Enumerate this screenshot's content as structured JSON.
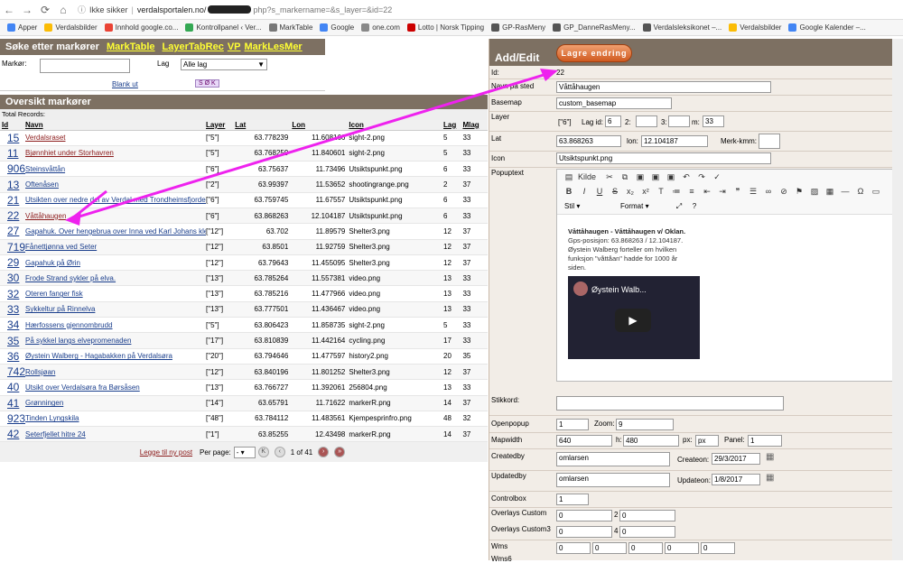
{
  "browser": {
    "url_security": "Ikke sikker",
    "url_domain": "verdalsportalen.no/",
    "url_path": "php?s_markername=&s_layer=&id=22"
  },
  "bookmarks": [
    "Apper",
    "Verdalsbilder",
    "Innhold google.co...",
    "Kontrollpanel ‹ Ver...",
    "MarkTable",
    "Google",
    "one.com",
    "Lotto | Norsk Tipping",
    "GP-RasMeny",
    "GP_DanneRasMeny...",
    "Verdalsleksikonet –...",
    "Verdalsbilder",
    "Google Kalender –..."
  ],
  "search": {
    "title": "Søke etter markører",
    "links": [
      "MarkTable",
      "LayerTabRec",
      "VP",
      "MarkLesMer"
    ],
    "marker_label": "Markør:",
    "lag_label": "Lag",
    "lag_value": "Alle lag",
    "blank_label": "Blank ut",
    "sok_label": "S Ø K"
  },
  "overview": {
    "title": "Oversikt markører",
    "total": "Total Records:",
    "columns": [
      "Id",
      "Navn",
      "Layer",
      "Lat",
      "Lon",
      "Icon",
      "Lag",
      "Mlag"
    ],
    "rows": [
      {
        "id": "15",
        "navn": "Verdalsraset",
        "layer": "[\"5\"]",
        "lat": "63.778239",
        "lon": "11.608166",
        "icon": "sight-2.png",
        "lag": "5",
        "mlag": "33",
        "red": true
      },
      {
        "id": "11",
        "navn": "Bjønnhiet under Storhavren",
        "layer": "[\"5\"]",
        "lat": "63.768259",
        "lon": "11.840601",
        "icon": "sight-2.png",
        "lag": "5",
        "mlag": "33",
        "red": true
      },
      {
        "id": "906",
        "navn": "Steinsvåttån",
        "layer": "[\"6\"]",
        "lat": "63.75637",
        "lon": "11.73496",
        "icon": "Utsiktspunkt.png",
        "lag": "6",
        "mlag": "33"
      },
      {
        "id": "13",
        "navn": "Oftenåsen",
        "layer": "[\"2\"]",
        "lat": "63.99397",
        "lon": "11.53652",
        "icon": "shootingrange.png",
        "lag": "2",
        "mlag": "37"
      },
      {
        "id": "21",
        "navn": "Utsikten over nedre del av Verdal med Trondheimsfjorden i bakgrunnen.",
        "layer": "[\"6\"]",
        "lat": "63.759745",
        "lon": "11.67557",
        "icon": "Utsiktspunkt.png",
        "lag": "6",
        "mlag": "33"
      },
      {
        "id": "22",
        "navn": "Våttåhaugen",
        "layer": "[\"6\"]",
        "lat": "63.868263",
        "lon": "12.104187",
        "icon": "Utsiktspunkt.png",
        "lag": "6",
        "mlag": "33",
        "red": true
      },
      {
        "id": "27",
        "navn": "Gapahuk. Over hengebrua over Inna ved Karl Johans kleiv.",
        "layer": "[\"12\"]",
        "lat": "63.702",
        "lon": "11.89579",
        "icon": "Shelter3.png",
        "lag": "12",
        "mlag": "37"
      },
      {
        "id": "719",
        "navn": "Fånettjønna ved Seter",
        "layer": "[\"12\"]",
        "lat": "63.8501",
        "lon": "11.92759",
        "icon": "Shelter3.png",
        "lag": "12",
        "mlag": "37"
      },
      {
        "id": "29",
        "navn": "Gapahuk på Ørin",
        "layer": "[\"12\"]",
        "lat": "63.79643",
        "lon": "11.455095",
        "icon": "Shelter3.png",
        "lag": "12",
        "mlag": "37"
      },
      {
        "id": "30",
        "navn": "Frode Strand sykler på elva.",
        "layer": "[\"13\"]",
        "lat": "63.785264",
        "lon": "11.557381",
        "icon": "video.png",
        "lag": "13",
        "mlag": "33"
      },
      {
        "id": "32",
        "navn": "Oteren fanger fisk",
        "layer": "[\"13\"]",
        "lat": "63.785216",
        "lon": "11.477966",
        "icon": "video.png",
        "lag": "13",
        "mlag": "33"
      },
      {
        "id": "33",
        "navn": "Sykkeltur på Rinnelva",
        "layer": "[\"13\"]",
        "lat": "63.777501",
        "lon": "11.436467",
        "icon": "video.png",
        "lag": "13",
        "mlag": "33"
      },
      {
        "id": "34",
        "navn": "Hærfossens gjennombrudd",
        "layer": "[\"5\"]",
        "lat": "63.806423",
        "lon": "11.858735",
        "icon": "sight-2.png",
        "lag": "5",
        "mlag": "33"
      },
      {
        "id": "35",
        "navn": "På sykkel langs elvepromenaden",
        "layer": "[\"17\"]",
        "lat": "63.810839",
        "lon": "11.442164",
        "icon": "cycling.png",
        "lag": "17",
        "mlag": "33"
      },
      {
        "id": "36",
        "navn": "Øystein Walberg - Hagabakken på Verdalsøra",
        "layer": "[\"20\"]",
        "lat": "63.794646",
        "lon": "11.477597",
        "icon": "history2.png",
        "lag": "20",
        "mlag": "35"
      },
      {
        "id": "742",
        "navn": "Rollsjøan",
        "layer": "[\"12\"]",
        "lat": "63.840196",
        "lon": "11.801252",
        "icon": "Shelter3.png",
        "lag": "12",
        "mlag": "37"
      },
      {
        "id": "40",
        "navn": "Utsikt over Verdalsøra fra Børsåsen",
        "layer": "[\"13\"]",
        "lat": "63.766727",
        "lon": "11.392061",
        "icon": "256804.png",
        "lag": "13",
        "mlag": "33"
      },
      {
        "id": "41",
        "navn": "Grønningen",
        "layer": "[\"14\"]",
        "lat": "63.65791",
        "lon": "11.71622",
        "icon": "markerR.png",
        "lag": "14",
        "mlag": "37"
      },
      {
        "id": "923",
        "navn": "Tinden Lyngskila",
        "layer": "[\"48\"]",
        "lat": "63.784112",
        "lon": "11.483561",
        "icon": "Kjempesprinfro.png",
        "lag": "48",
        "mlag": "32"
      },
      {
        "id": "42",
        "navn": "Seterfjellet hitre 24",
        "layer": "[\"1\"]",
        "lat": "63.85255",
        "lon": "12.43498",
        "icon": "markerR.png",
        "lag": "14",
        "mlag": "37"
      }
    ],
    "pager": {
      "new_post": "Legge til ny post",
      "per_page_label": "Per page:",
      "per_page": "-",
      "page_text": "1 of 41"
    }
  },
  "edit": {
    "title": "Add/Edit",
    "save_label": "Lagre endring",
    "id_label": "Id:",
    "id_value": "22",
    "navn_label": "Navn på sted",
    "navn_value": "Våttåhaugen",
    "basemap_label": "Basemap",
    "basemap_value": "custom_basemap",
    "layer_label": "Layer",
    "layer_value": "[\"6\"]",
    "lagid_label": "Lag id:",
    "lagid_value": "6",
    "l2": "2:",
    "l3": "3:",
    "lm": "m:",
    "m_value": "33",
    "lat_label": "Lat",
    "lat_value": "63.868263",
    "lon_label": "lon:",
    "lon_value": "12.104187",
    "merk_label": "Merk-kmm:",
    "icon_label": "Icon",
    "icon_value": "Utsiktspunkt.png",
    "popup_label": "Popuptext",
    "kilde": "Kilde",
    "stil": "Stil",
    "format": "Format",
    "popup_title": "Våttåhaugen - Våttåhaugen v/ Oklan.",
    "popup_line1": "Gps-posisjon: 63.868263 / 12.104187.",
    "popup_line2": "Øystein Walberg forteller om hvilken",
    "popup_line3": "funksjon \"våttåan\" hadde for 1000 år",
    "popup_line4": "siden.",
    "video_title": "Øystein Walb...",
    "stikkord_label": "Stikkord:",
    "openpopup_label": "Openpopup",
    "openpopup_value": "1",
    "zoom_label": "Zoom:",
    "zoom_value": "9",
    "mapwidth_label": "Mapwidth",
    "mapwidth_value": "640",
    "h_label": "h:",
    "h_value": "480",
    "px_label": "px:",
    "px_value": "px",
    "panel_label": "Panel:",
    "panel_value": "1",
    "createdby_label": "Createdby",
    "createdby_value": "omlarsen",
    "createon_label": "Createon:",
    "createon_value": "29/3/2017",
    "updatedby_label": "Updatedby",
    "updatedby_value": "omlarsen",
    "updateon_label": "Updateon:",
    "updateon_value": "1/8/2017",
    "controlbox_label": "Controlbox",
    "controlbox_value": "1",
    "ovc_label": "Overlays Custom",
    "ovc_v1": "0",
    "ovc_n": "2",
    "ovc_v2": "0",
    "ovc3_label": "Overlays Custom3",
    "ovc3_v1": "0",
    "ovc3_n": "4",
    "ovc3_v2": "0",
    "wms_label": "Wms",
    "wms_vals": [
      "0",
      "0",
      "0",
      "0",
      "0"
    ],
    "wms6_label": "Wms6"
  }
}
